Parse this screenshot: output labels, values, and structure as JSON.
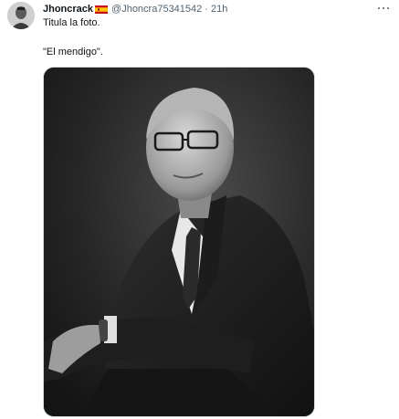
{
  "author": {
    "display_name": "Jhoncrack",
    "handle": "@Jhoncra75341542",
    "separator": "·",
    "time": "21h",
    "flag_icon": "spain-flag-icon"
  },
  "tweet": {
    "line1": "Titula la foto.",
    "line2": "\"El mendigo\"."
  },
  "media": {
    "kind": "black-and-white portrait photo of a man in suit with glasses and wristwatch"
  },
  "colors": {
    "text": "#0f1419",
    "secondary": "#536471",
    "border": "#cfd9de"
  }
}
